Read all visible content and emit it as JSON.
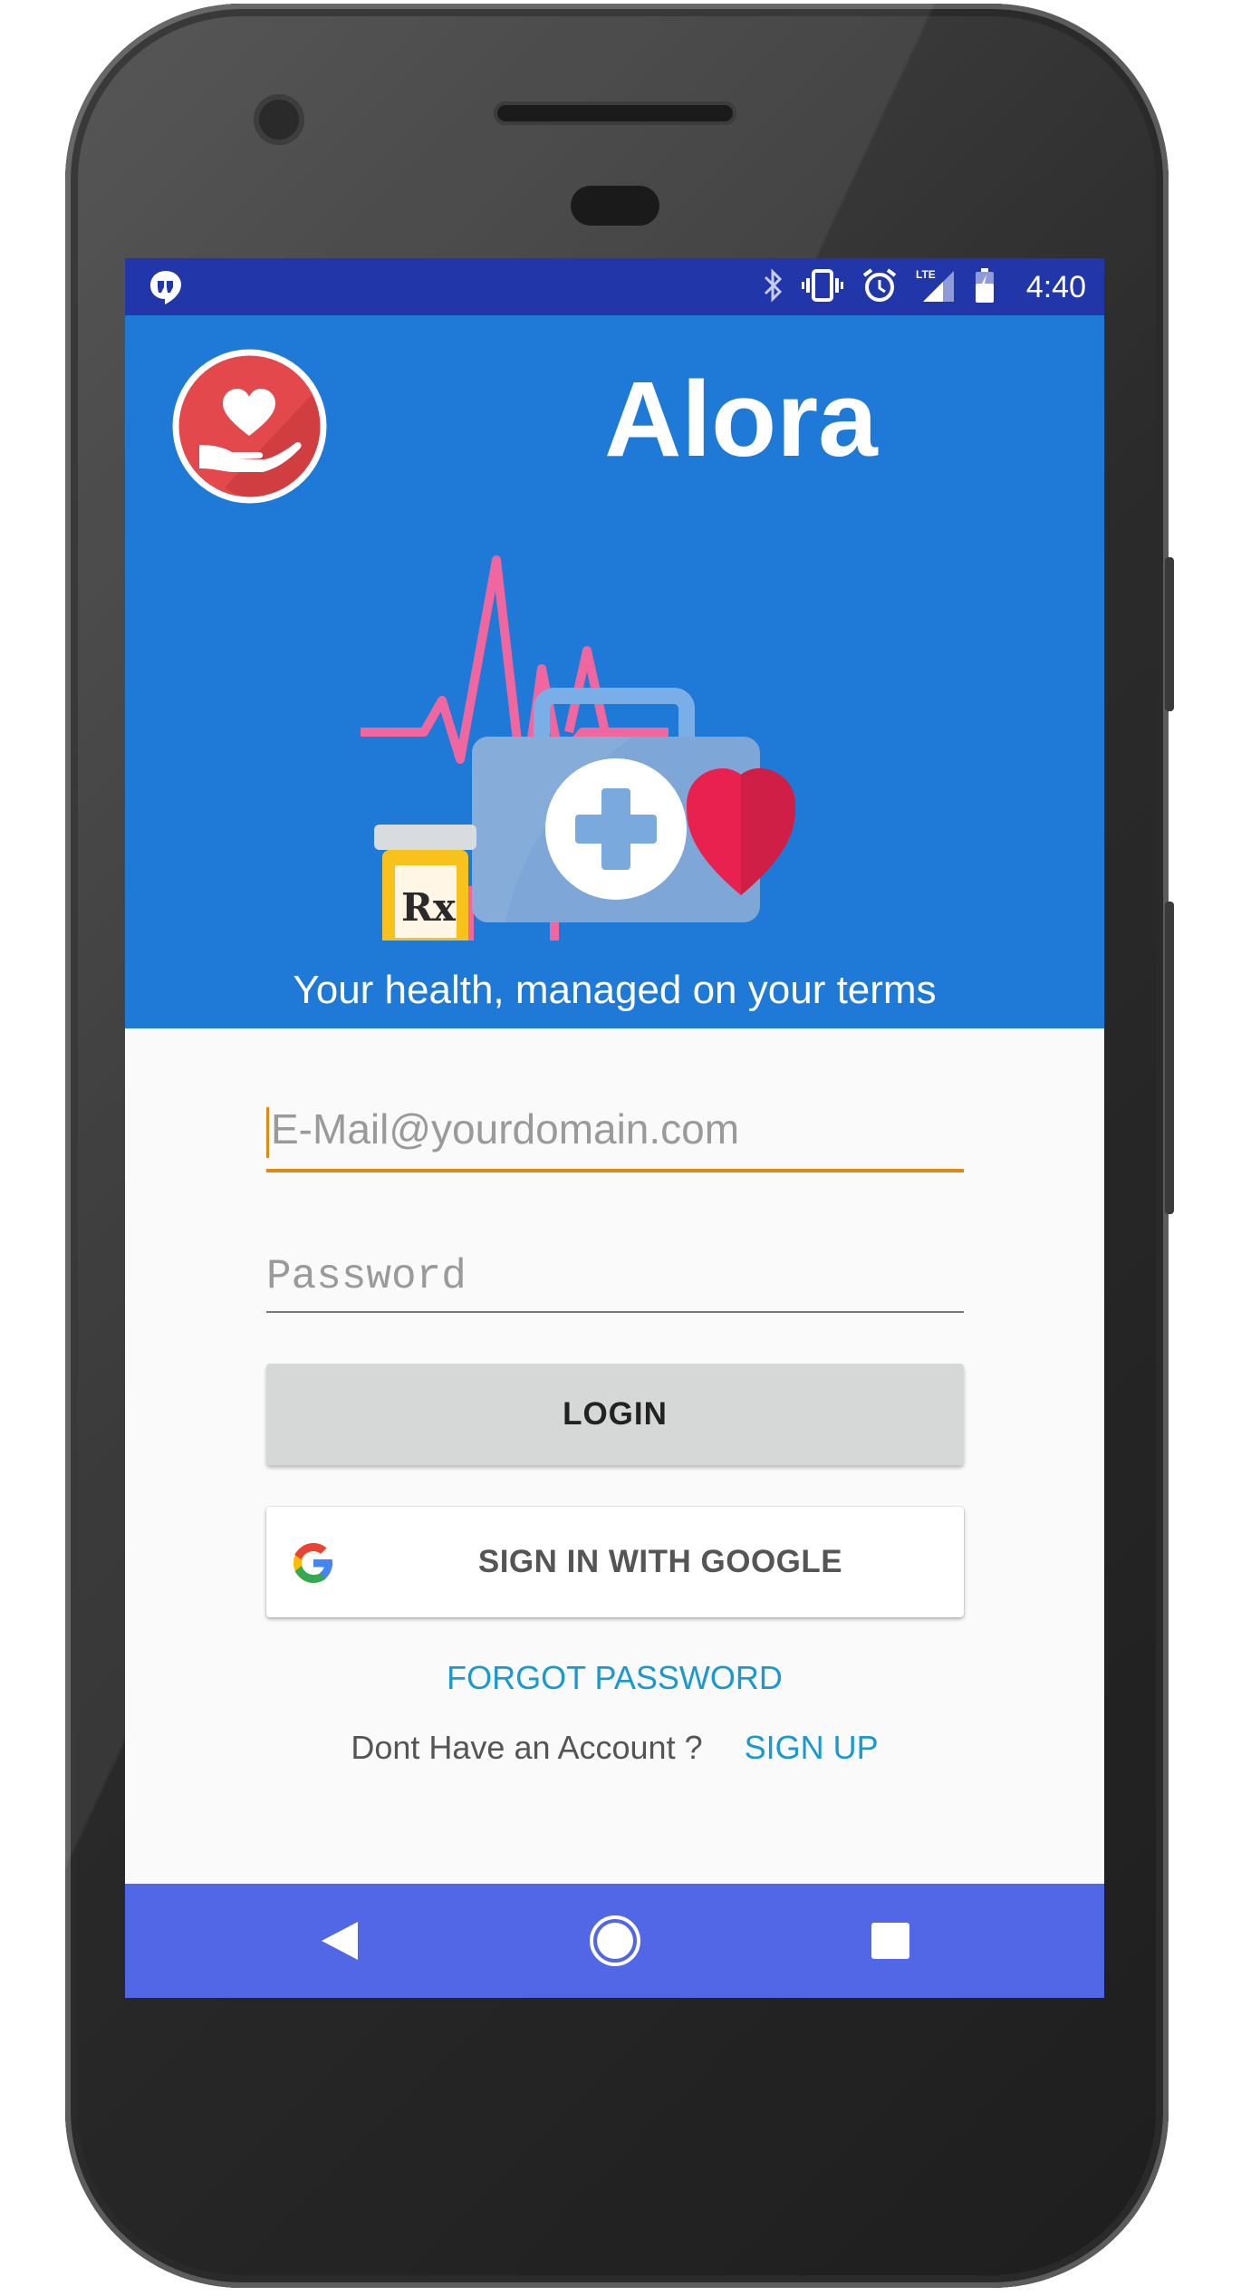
{
  "status_bar": {
    "time": "4:40",
    "icons": [
      "hangouts-icon",
      "bluetooth-icon",
      "vibrate-icon",
      "alarm-icon",
      "lte-signal-icon",
      "battery-icon"
    ]
  },
  "header": {
    "app_title": "Alora",
    "tagline": "Your health, managed on your terms",
    "rx_label": "Rx",
    "background_color": "#1e7ad6"
  },
  "login_form": {
    "email_placeholder": "E-Mail@yourdomain.com",
    "password_placeholder": "Password",
    "login_label": "LOGIN",
    "google_label": "SIGN IN WITH GOOGLE",
    "forgot_password": "FORGOT PASSWORD",
    "no_account_text": "Dont Have an Account ?",
    "sign_up": "SIGN UP"
  },
  "nav_bar": {
    "buttons": [
      "back-icon",
      "home-icon",
      "recents-icon"
    ],
    "background_color": "#5167e6"
  },
  "colors": {
    "status_bar": "#2136a9",
    "accent": "#e08a14",
    "link": "#1a99cf"
  }
}
